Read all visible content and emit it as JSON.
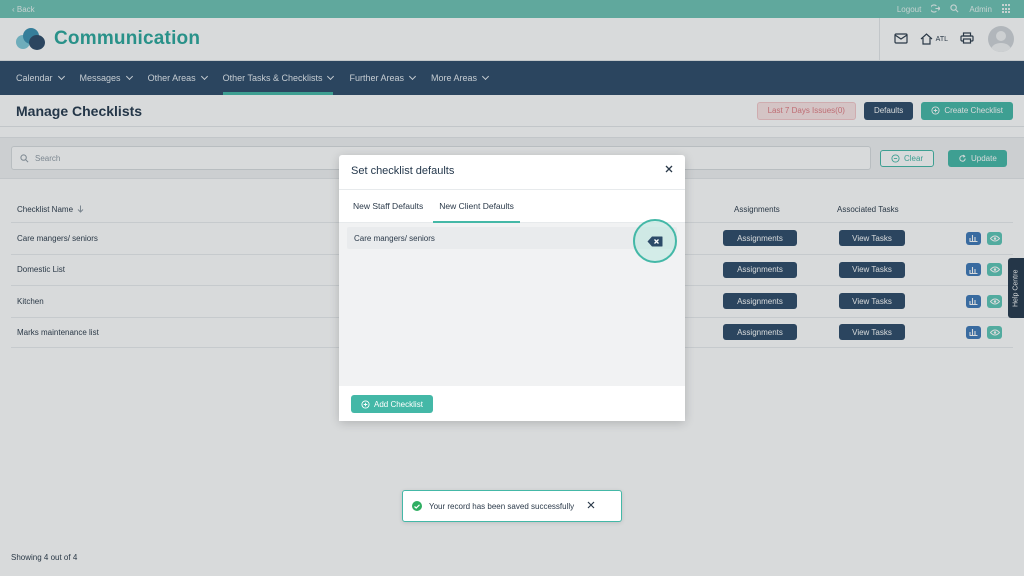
{
  "topbar": {
    "back": "‹ Back",
    "logout": "Logout",
    "user": "Admin"
  },
  "header": {
    "title": "Communication",
    "location_label": "ATL"
  },
  "nav": {
    "items": [
      {
        "label": "Calendar"
      },
      {
        "label": "Messages"
      },
      {
        "label": "Other Areas"
      },
      {
        "label": "Other Tasks & Checklists"
      },
      {
        "label": "Further Areas"
      },
      {
        "label": "More Areas"
      }
    ],
    "active_index": 3
  },
  "page": {
    "title": "Manage Checklists",
    "issues_button": "Last 7 Days Issues(0)",
    "defaults_button": "Defaults",
    "create_button": "Create Checklist"
  },
  "search": {
    "placeholder": "Search",
    "clear": "Clear",
    "update": "Update"
  },
  "table": {
    "headers": {
      "name": "Checklist Name",
      "assignments": "Assignments",
      "tasks": "Associated Tasks"
    },
    "rows": [
      {
        "name": "Care mangers/ seniors",
        "assign_label": "Assignments",
        "tasks_label": "View Tasks"
      },
      {
        "name": "Domestic List",
        "assign_label": "Assignments",
        "tasks_label": "View Tasks"
      },
      {
        "name": "Kitchen",
        "assign_label": "Assignments",
        "tasks_label": "View Tasks"
      },
      {
        "name": "Marks maintenance list",
        "assign_label": "Assignments",
        "tasks_label": "View Tasks"
      }
    ]
  },
  "help": "Help Centre",
  "footer": {
    "showing": "Showing 4 out of 4"
  },
  "modal": {
    "title": "Set checklist defaults",
    "tabs": [
      {
        "label": "New Staff Defaults"
      },
      {
        "label": "New Client Defaults"
      }
    ],
    "active_tab": 1,
    "rows": [
      {
        "name": "Care mangers/ seniors"
      }
    ],
    "add_button": "Add Checklist"
  },
  "toast": {
    "message": "Your record has been saved successfully"
  },
  "colors": {
    "teal": "#44b8a7",
    "navy": "#2c4a68",
    "brand": "#2aa79b"
  }
}
